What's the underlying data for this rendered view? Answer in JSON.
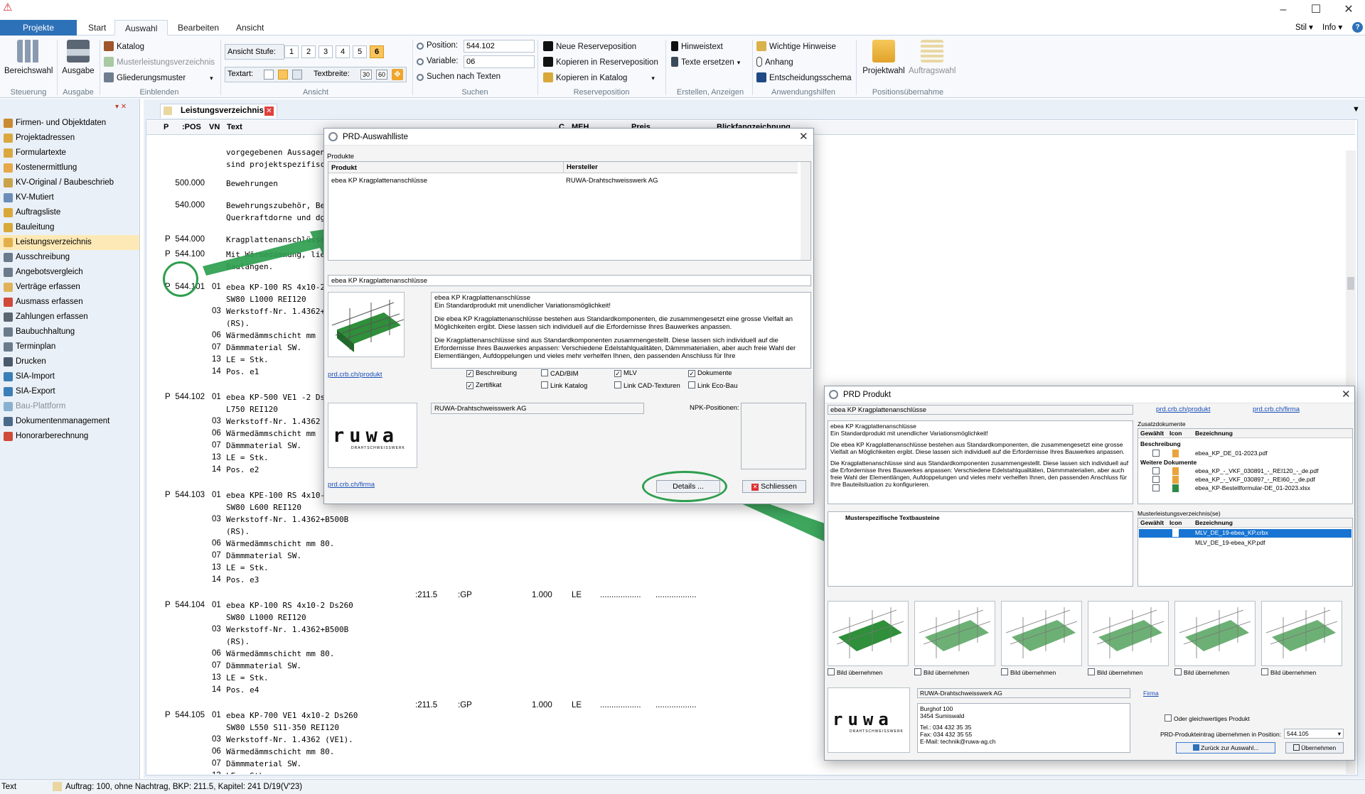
{
  "app": {
    "icon": "app-triangle-icon",
    "window_buttons": [
      "–",
      "☐",
      "✕"
    ],
    "right_menu": {
      "stil": "Stil",
      "info": "Info",
      "help": "?"
    }
  },
  "tabs": [
    "Projekte",
    "Start",
    "Auswahl",
    "Bearbeiten",
    "Ansicht"
  ],
  "ribbon": {
    "steuerung": {
      "btn": "Bereichswahl",
      "label": "Steuerung"
    },
    "ausgabe": {
      "btn": "Ausgabe",
      "label": "Ausgabe"
    },
    "einblenden": {
      "items": [
        "Katalog",
        "Musterleistungsverzeichnis",
        "Gliederungsmuster"
      ],
      "label": "Einblenden"
    },
    "ansicht": {
      "stufe_label": "Ansicht Stufe:",
      "stufen": [
        "1",
        "2",
        "3",
        "4",
        "5",
        "6"
      ],
      "textart_label": "Textart:",
      "textbreite_label": "Textbreite:",
      "tb1": "30",
      "tb2": "60",
      "label": "Ansicht"
    },
    "suchen": {
      "position_label": "Position:",
      "position_value": "544.102",
      "variable_label": "Variable:",
      "variable_value": "06",
      "text_search": "Suchen nach Texten",
      "label": "Suchen"
    },
    "reserve": {
      "items": [
        "Neue Reserveposition",
        "Kopieren in Reserveposition",
        "Kopieren in Katalog"
      ],
      "label": "Reserveposition"
    },
    "erstellen": {
      "items": [
        "Hinweistext",
        "Texte ersetzen"
      ],
      "label": "Erstellen, Anzeigen"
    },
    "hilfen": {
      "items": [
        "Wichtige Hinweise",
        "Anhang",
        "Entscheidungsschema"
      ],
      "label": "Anwendungshilfen"
    },
    "posuebernahme": {
      "items": [
        "Projektwahl",
        "Auftragswahl"
      ],
      "label": "Positionsübernahme"
    }
  },
  "sidebar": {
    "pin": "▾ ✕",
    "items": [
      "Firmen- und Objektdaten",
      "Projektadressen",
      "Formulartexte",
      "Kostenermittlung",
      "KV-Original / Baubeschrieb",
      "KV-Mutiert",
      "Auftragsliste",
      "Bauleitung",
      "Leistungsverzeichnis",
      "Ausschreibung",
      "Angebotsvergleich",
      "Verträge erfassen",
      "Ausmass erfassen",
      "Zahlungen erfassen",
      "Baubuchhaltung",
      "Terminplan",
      "Drucken",
      "SIA-Import",
      "SIA-Export",
      "Bau-Plattform",
      "Dokumentenmanagement",
      "Honorarberechnung"
    ],
    "selected": "Leistungsverzeichnis",
    "disabled": "Bau-Plattform"
  },
  "doc": {
    "tab": "Leistungsverzeichnis",
    "columns": {
      "p": "P",
      ":pos": ":POS",
      "vn": "VN",
      "text": "Text",
      "c": "C",
      "meh": "MEH",
      "preis": "Preis",
      "blick": "Blickfangzeichnung"
    },
    "rows": [
      {
        "p": "",
        "pos": "",
        "vn": "",
        "text": "vorgegebenen Aussagen, s"
      },
      {
        "p": "",
        "pos": "",
        "vn": "",
        "text": "sind projektspezifisch for"
      },
      {
        "p": "",
        "pos": "500.000",
        "vn": "",
        "text": "Bewehrungen"
      },
      {
        "p": "",
        "pos": "540.000",
        "vn": "",
        "text": "Bewehrungszubehör, Bewe"
      },
      {
        "p": "",
        "pos": "",
        "vn": "",
        "text": "Querkraftdorne und dgl."
      },
      {
        "p": "P",
        "pos": "544.000",
        "vn": "",
        "text": "Kragplattenanschlüsse"
      },
      {
        "p": "P",
        "pos": "544.100",
        "vn": "",
        "text": "Mit Wärmedämmung, lief"
      },
      {
        "p": "",
        "pos": "",
        "vn": "",
        "text": "Baulängen."
      },
      {
        "p": "P",
        "pos": "544.101",
        "vn": "01",
        "text": "ebea KP-100 RS 4x10-2 Ds"
      },
      {
        "p": "",
        "pos": "",
        "vn": "",
        "text": "SW80 L1000 REI120"
      },
      {
        "p": "",
        "pos": "",
        "vn": "03",
        "text": "Werkstoff-Nr. 1.4362+B50"
      },
      {
        "p": "",
        "pos": "",
        "vn": "",
        "text": "(RS)."
      },
      {
        "p": "",
        "pos": "",
        "vn": "06",
        "text": "Wärmedämmschicht mm"
      },
      {
        "p": "",
        "pos": "",
        "vn": "07",
        "text": "Dämmmaterial SW."
      },
      {
        "p": "",
        "pos": "",
        "vn": "13",
        "text": "LE = Stk."
      },
      {
        "p": "",
        "pos": "",
        "vn": "14",
        "text": "Pos. e1"
      },
      {
        "p": "P",
        "pos": "544.102",
        "vn": "01",
        "text": "ebea KP-500 VE1 -2 Ds20"
      },
      {
        "p": "",
        "pos": "",
        "vn": "",
        "text": "L750 REI120"
      },
      {
        "p": "",
        "pos": "",
        "vn": "03",
        "text": "Werkstoff-Nr. 1.4362 (VE1"
      },
      {
        "p": "",
        "pos": "",
        "vn": "06",
        "text": "Wärmedämmschicht mm"
      },
      {
        "p": "",
        "pos": "",
        "vn": "07",
        "text": "Dämmmaterial SW."
      },
      {
        "p": "",
        "pos": "",
        "vn": "13",
        "text": "LE = Stk."
      },
      {
        "p": "",
        "pos": "",
        "vn": "14",
        "text": "Pos. e2"
      },
      {
        "p": "P",
        "pos": "544.103",
        "vn": "01",
        "text": "ebea KPE-100 RS 4x10-3 D"
      },
      {
        "p": "",
        "pos": "",
        "vn": "",
        "text": "SW80 L600 REI120"
      },
      {
        "p": "",
        "pos": "",
        "vn": "03",
        "text": "Werkstoff-Nr. 1.4362+B500B"
      },
      {
        "p": "",
        "pos": "",
        "vn": "",
        "text": "(RS)."
      },
      {
        "p": "",
        "pos": "",
        "vn": "06",
        "text": "Wärmedämmschicht mm 80."
      },
      {
        "p": "",
        "pos": "",
        "vn": "07",
        "text": "Dämmmaterial SW."
      },
      {
        "p": "",
        "pos": "",
        "vn": "13",
        "text": "LE = Stk."
      },
      {
        "p": "",
        "pos": "",
        "vn": "14",
        "text": "Pos. e3"
      },
      {
        "p": "P",
        "pos": "544.104",
        "vn": "01",
        "text": "ebea KP-100 RS 4x10-2 Ds260"
      },
      {
        "p": "",
        "pos": "",
        "vn": "",
        "text": "SW80 L1000 REI120"
      },
      {
        "p": "",
        "pos": "",
        "vn": "03",
        "text": "Werkstoff-Nr. 1.4362+B500B"
      },
      {
        "p": "",
        "pos": "",
        "vn": "",
        "text": "(RS)."
      },
      {
        "p": "",
        "pos": "",
        "vn": "06",
        "text": "Wärmedämmschicht mm 80."
      },
      {
        "p": "",
        "pos": "",
        "vn": "07",
        "text": "Dämmmaterial SW."
      },
      {
        "p": "",
        "pos": "",
        "vn": "13",
        "text": "LE = Stk."
      },
      {
        "p": "",
        "pos": "",
        "vn": "14",
        "text": "Pos. e4"
      },
      {
        "p": "P",
        "pos": "544.105",
        "vn": "01",
        "text": "ebea KP-700 VE1 4x10-2 Ds260"
      },
      {
        "p": "",
        "pos": "",
        "vn": "",
        "text": "SW80 L550 S11-350 REI120"
      },
      {
        "p": "",
        "pos": "",
        "vn": "03",
        "text": "Werkstoff-Nr. 1.4362 (VE1)."
      },
      {
        "p": "",
        "pos": "",
        "vn": "06",
        "text": "Wärmedämmschicht mm 80."
      },
      {
        "p": "",
        "pos": "",
        "vn": "07",
        "text": "Dämmmaterial SW."
      },
      {
        "p": "",
        "pos": "",
        "vn": "13",
        "text": "LE = Stk."
      },
      {
        "p": "",
        "pos": "",
        "vn": "14",
        "text": "Pos. e5"
      }
    ],
    "qty_rows": [
      {
        "bkp": ":211.5",
        "gp": ":GP",
        "menge": "1.000",
        "meh": "LE",
        "dots1": "..................",
        "dots2": ".................."
      },
      {
        "bkp": ":211.5",
        "gp": ":GP",
        "menge": "1.000",
        "meh": "LE",
        "dots1": "..................",
        "dots2": ".................."
      }
    ]
  },
  "status": {
    "left": "Text",
    "info": "Auftrag: 100,  ohne Nachtrag,  BKP: 211.5,  Kapitel: 241  D/19(V'23)"
  },
  "dlg1": {
    "title": "PRD-Auswahlliste",
    "section": "Produkte",
    "col_produkt": "Produkt",
    "col_hersteller": "Hersteller",
    "row": {
      "produkt": "ebea KP Kragplattenanschlüsse",
      "hersteller": "RUWA-Drahtschweisswerk AG"
    },
    "product_name": "ebea KP Kragplattenanschlüsse",
    "desc": [
      "ebea KP Kragplattenanschlüsse",
      "Ein Standardprodukt mit unendlicher Variationsmöglichkeit!",
      "",
      "Die ebea KP Kragplattenanschlüsse bestehen aus Standardkomponenten, die zusammengesetzt eine grosse Vielfalt an Möglichkeiten ergibt. Diese lassen sich individuell auf die Erfordernisse Ihres Bauwerkes anpassen.",
      "",
      "Die Kragplattenanschlüsse sind aus Standardkomponenten zusammengestellt. Diese lassen sich individuell auf die Erfordernisse Ihres Bauwerkes anpassen: Verschiedene Edelstahlqualitäten, Dämmmaterialien, aber auch freie Wahl der Elementlängen, Aufdoppelungen und vieles mehr verhelfen Ihnen, den passenden Anschluss für Ihre"
    ],
    "link_produkt": "prd.crb.ch/produkt",
    "link_firma": "prd.crb.ch/firma",
    "checks": [
      {
        "label": "Beschreibung",
        "on": true
      },
      {
        "label": "CAD/BIM",
        "on": false
      },
      {
        "label": "MLV",
        "on": true
      },
      {
        "label": "Dokumente",
        "on": true
      },
      {
        "label": "Zertifikat",
        "on": true
      },
      {
        "label": "Link Katalog",
        "on": false
      },
      {
        "label": "Link CAD-Texturen",
        "on": false
      },
      {
        "label": "Link Eco-Bau",
        "on": false
      }
    ],
    "firm": "RUWA-Drahtschweisswerk AG",
    "npk_label": "NPK-Positionen:",
    "details_btn": "Details ...",
    "close_btn": "Schliessen",
    "logo": "ruwa",
    "logo_sub": "DRAHTSCHWEISSWERK"
  },
  "dlg2": {
    "title": "PRD Produkt",
    "product": "ebea KP Kragplattenanschlüsse",
    "link_produkt": "prd.crb.ch/produkt",
    "link_firma": "prd.crb.ch/firma",
    "desc": [
      "ebea KP Kragplattenanschlüsse",
      "Ein Standardprodukt mit unendlicher Variationsmöglichkeit!",
      "",
      "Die ebea KP Kragplattenanschlüsse bestehen aus Standardkomponenten, die zusammengesetzt eine grosse Vielfalt an Möglichkeiten ergibt. Diese lassen sich individuell auf die Erfordernisse Ihres Bauwerkes anpassen.",
      "",
      "Die Kragplattenanschlüsse sind aus Standardkomponenten zusammengestellt. Diese lassen sich individuell auf die Erfordernisse Ihres Bauwerkes anpassen: Verschiedene Edelstahlqualitäten, Dämmmaterialien, aber auch freie Wahl der Elementlängen, Aufdoppelungen und vieles mehr verhelfen Ihnen, den passenden Anschluss für Ihre Bauteilsituation zu konfigurieren."
    ],
    "zusatz_label": "Zusatzdokumente",
    "col_gewaehlt": "Gewählt",
    "col_icon": "Icon",
    "col_bez": "Bezeichnung",
    "grp1": "Beschreibung",
    "doc1": "ebea_KP_DE_01-2023.pdf",
    "grp2": "Weitere Dokumente",
    "docs": [
      "ebea_KP_-_VKF_030891_-_REI120_-_de.pdf",
      "ebea_KP_-_VKF_030897_-_REI60_-_de.pdf",
      "ebea_KP-Bestellformular-DE_01-2023.xlsx"
    ],
    "muster_label": "Musterspezifische Textbausteine",
    "mlv_label": "Musterleistungsverzeichnis(se)",
    "mlv": [
      "MLV_DE_19-ebea_KP.crbx",
      "MLV_DE_19-ebea_KP.pdf"
    ],
    "bild": "Bild übernehmen",
    "firm": "RUWA-Drahtschweisswerk AG",
    "firma_link": "Firma",
    "address": [
      "Burghof 100",
      "3454 Sumiswald",
      "",
      "Tel.: 034 432 35 35",
      "Fax: 034 432 35 55",
      "E-Mail: technik@ruwa-ag.ch"
    ],
    "gleich": "Oder gleichwertiges Produkt",
    "pos_label": "PRD-Produkteintrag übernehmen in Position:",
    "pos_value": "544.105",
    "back_btn": "Zurück zur Auswahl...",
    "take_btn": "Übernehmen"
  },
  "colors": {
    "accent": "#2d71b8",
    "highlight_green": "#2e9e4f",
    "selected_nav": "#fde9b5",
    "selected_row": "#1874d2"
  }
}
